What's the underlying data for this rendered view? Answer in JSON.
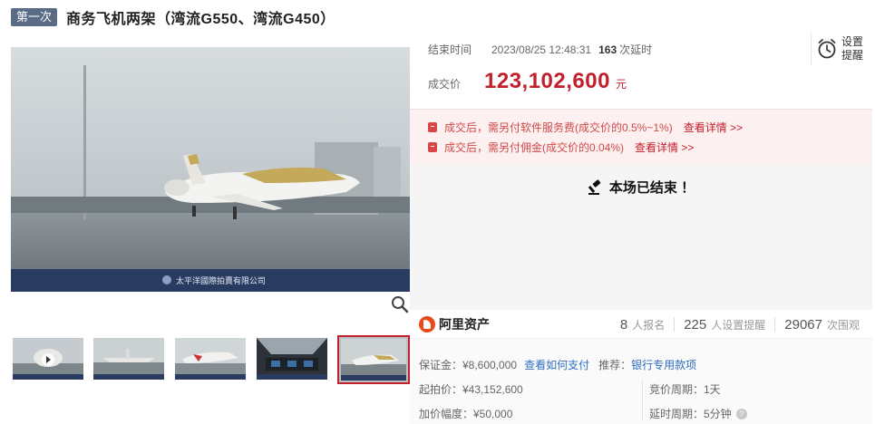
{
  "header": {
    "round_badge": "第一次",
    "title": "商务飞机两架（湾流G550、湾流G450）"
  },
  "gallery": {
    "watermark": "太平洋國際拍賣有限公司",
    "thumbnails": [
      "video",
      "plane-front",
      "plane-side",
      "cockpit",
      "plane-wide"
    ],
    "active_index": 4
  },
  "auction": {
    "end_label": "结束时间",
    "end_time": "2023/08/25 12:48:31",
    "delay_count": "163",
    "delay_label": "次延时",
    "remind_label_1": "设置",
    "remind_label_2": "提醒",
    "deal_label": "成交价",
    "deal_price": "123,102,600",
    "deal_unit": "元"
  },
  "notices": [
    {
      "text": "成交后，需另付软件服务费(成交价的0.5%~1%)",
      "link": "查看详情 >>"
    },
    {
      "text": "成交后，需另付佣金(成交价的0.04%)",
      "link": "查看详情 >>"
    }
  ],
  "status": {
    "ended_text": "本场已结束 ！"
  },
  "brand": {
    "name": "阿里资产",
    "signups": "8",
    "signups_label": "人报名",
    "reminders": "225",
    "reminders_label": "人设置提醒",
    "views": "29067",
    "views_label": "次围观"
  },
  "details": {
    "deposit": "保证金：¥8,600,000",
    "how_to_pay": "查看如何支付",
    "recommend_label": "推荐：",
    "recommend_link": "银行专用款项",
    "start_price": "起拍价：¥43,152,600",
    "bid_period": "竞价周期：1天",
    "increment": "加价幅度：¥50,000",
    "delay_period": "延时周期：5分钟"
  },
  "colors": {
    "accent": "#c2202b",
    "badge": "#5a6b86",
    "link": "#2d6ec0",
    "notice_bg": "#fdf0f0"
  }
}
